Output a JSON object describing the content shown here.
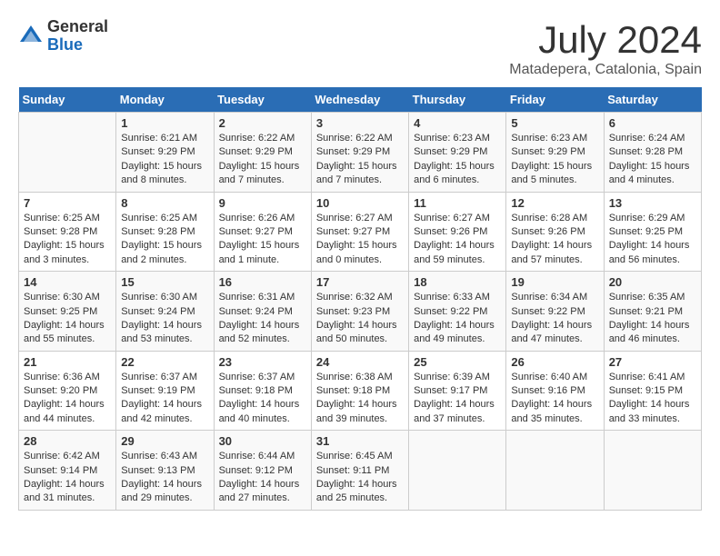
{
  "logo": {
    "general": "General",
    "blue": "Blue"
  },
  "title": "July 2024",
  "location": "Matadepera, Catalonia, Spain",
  "headers": [
    "Sunday",
    "Monday",
    "Tuesday",
    "Wednesday",
    "Thursday",
    "Friday",
    "Saturday"
  ],
  "weeks": [
    [
      {
        "day": "",
        "sunrise": "",
        "sunset": "",
        "daylight": ""
      },
      {
        "day": "1",
        "sunrise": "Sunrise: 6:21 AM",
        "sunset": "Sunset: 9:29 PM",
        "daylight": "Daylight: 15 hours and 8 minutes."
      },
      {
        "day": "2",
        "sunrise": "Sunrise: 6:22 AM",
        "sunset": "Sunset: 9:29 PM",
        "daylight": "Daylight: 15 hours and 7 minutes."
      },
      {
        "day": "3",
        "sunrise": "Sunrise: 6:22 AM",
        "sunset": "Sunset: 9:29 PM",
        "daylight": "Daylight: 15 hours and 7 minutes."
      },
      {
        "day": "4",
        "sunrise": "Sunrise: 6:23 AM",
        "sunset": "Sunset: 9:29 PM",
        "daylight": "Daylight: 15 hours and 6 minutes."
      },
      {
        "day": "5",
        "sunrise": "Sunrise: 6:23 AM",
        "sunset": "Sunset: 9:29 PM",
        "daylight": "Daylight: 15 hours and 5 minutes."
      },
      {
        "day": "6",
        "sunrise": "Sunrise: 6:24 AM",
        "sunset": "Sunset: 9:28 PM",
        "daylight": "Daylight: 15 hours and 4 minutes."
      }
    ],
    [
      {
        "day": "7",
        "sunrise": "Sunrise: 6:25 AM",
        "sunset": "Sunset: 9:28 PM",
        "daylight": "Daylight: 15 hours and 3 minutes."
      },
      {
        "day": "8",
        "sunrise": "Sunrise: 6:25 AM",
        "sunset": "Sunset: 9:28 PM",
        "daylight": "Daylight: 15 hours and 2 minutes."
      },
      {
        "day": "9",
        "sunrise": "Sunrise: 6:26 AM",
        "sunset": "Sunset: 9:27 PM",
        "daylight": "Daylight: 15 hours and 1 minute."
      },
      {
        "day": "10",
        "sunrise": "Sunrise: 6:27 AM",
        "sunset": "Sunset: 9:27 PM",
        "daylight": "Daylight: 15 hours and 0 minutes."
      },
      {
        "day": "11",
        "sunrise": "Sunrise: 6:27 AM",
        "sunset": "Sunset: 9:26 PM",
        "daylight": "Daylight: 14 hours and 59 minutes."
      },
      {
        "day": "12",
        "sunrise": "Sunrise: 6:28 AM",
        "sunset": "Sunset: 9:26 PM",
        "daylight": "Daylight: 14 hours and 57 minutes."
      },
      {
        "day": "13",
        "sunrise": "Sunrise: 6:29 AM",
        "sunset": "Sunset: 9:25 PM",
        "daylight": "Daylight: 14 hours and 56 minutes."
      }
    ],
    [
      {
        "day": "14",
        "sunrise": "Sunrise: 6:30 AM",
        "sunset": "Sunset: 9:25 PM",
        "daylight": "Daylight: 14 hours and 55 minutes."
      },
      {
        "day": "15",
        "sunrise": "Sunrise: 6:30 AM",
        "sunset": "Sunset: 9:24 PM",
        "daylight": "Daylight: 14 hours and 53 minutes."
      },
      {
        "day": "16",
        "sunrise": "Sunrise: 6:31 AM",
        "sunset": "Sunset: 9:24 PM",
        "daylight": "Daylight: 14 hours and 52 minutes."
      },
      {
        "day": "17",
        "sunrise": "Sunrise: 6:32 AM",
        "sunset": "Sunset: 9:23 PM",
        "daylight": "Daylight: 14 hours and 50 minutes."
      },
      {
        "day": "18",
        "sunrise": "Sunrise: 6:33 AM",
        "sunset": "Sunset: 9:22 PM",
        "daylight": "Daylight: 14 hours and 49 minutes."
      },
      {
        "day": "19",
        "sunrise": "Sunrise: 6:34 AM",
        "sunset": "Sunset: 9:22 PM",
        "daylight": "Daylight: 14 hours and 47 minutes."
      },
      {
        "day": "20",
        "sunrise": "Sunrise: 6:35 AM",
        "sunset": "Sunset: 9:21 PM",
        "daylight": "Daylight: 14 hours and 46 minutes."
      }
    ],
    [
      {
        "day": "21",
        "sunrise": "Sunrise: 6:36 AM",
        "sunset": "Sunset: 9:20 PM",
        "daylight": "Daylight: 14 hours and 44 minutes."
      },
      {
        "day": "22",
        "sunrise": "Sunrise: 6:37 AM",
        "sunset": "Sunset: 9:19 PM",
        "daylight": "Daylight: 14 hours and 42 minutes."
      },
      {
        "day": "23",
        "sunrise": "Sunrise: 6:37 AM",
        "sunset": "Sunset: 9:18 PM",
        "daylight": "Daylight: 14 hours and 40 minutes."
      },
      {
        "day": "24",
        "sunrise": "Sunrise: 6:38 AM",
        "sunset": "Sunset: 9:18 PM",
        "daylight": "Daylight: 14 hours and 39 minutes."
      },
      {
        "day": "25",
        "sunrise": "Sunrise: 6:39 AM",
        "sunset": "Sunset: 9:17 PM",
        "daylight": "Daylight: 14 hours and 37 minutes."
      },
      {
        "day": "26",
        "sunrise": "Sunrise: 6:40 AM",
        "sunset": "Sunset: 9:16 PM",
        "daylight": "Daylight: 14 hours and 35 minutes."
      },
      {
        "day": "27",
        "sunrise": "Sunrise: 6:41 AM",
        "sunset": "Sunset: 9:15 PM",
        "daylight": "Daylight: 14 hours and 33 minutes."
      }
    ],
    [
      {
        "day": "28",
        "sunrise": "Sunrise: 6:42 AM",
        "sunset": "Sunset: 9:14 PM",
        "daylight": "Daylight: 14 hours and 31 minutes."
      },
      {
        "day": "29",
        "sunrise": "Sunrise: 6:43 AM",
        "sunset": "Sunset: 9:13 PM",
        "daylight": "Daylight: 14 hours and 29 minutes."
      },
      {
        "day": "30",
        "sunrise": "Sunrise: 6:44 AM",
        "sunset": "Sunset: 9:12 PM",
        "daylight": "Daylight: 14 hours and 27 minutes."
      },
      {
        "day": "31",
        "sunrise": "Sunrise: 6:45 AM",
        "sunset": "Sunset: 9:11 PM",
        "daylight": "Daylight: 14 hours and 25 minutes."
      },
      {
        "day": "",
        "sunrise": "",
        "sunset": "",
        "daylight": ""
      },
      {
        "day": "",
        "sunrise": "",
        "sunset": "",
        "daylight": ""
      },
      {
        "day": "",
        "sunrise": "",
        "sunset": "",
        "daylight": ""
      }
    ]
  ]
}
